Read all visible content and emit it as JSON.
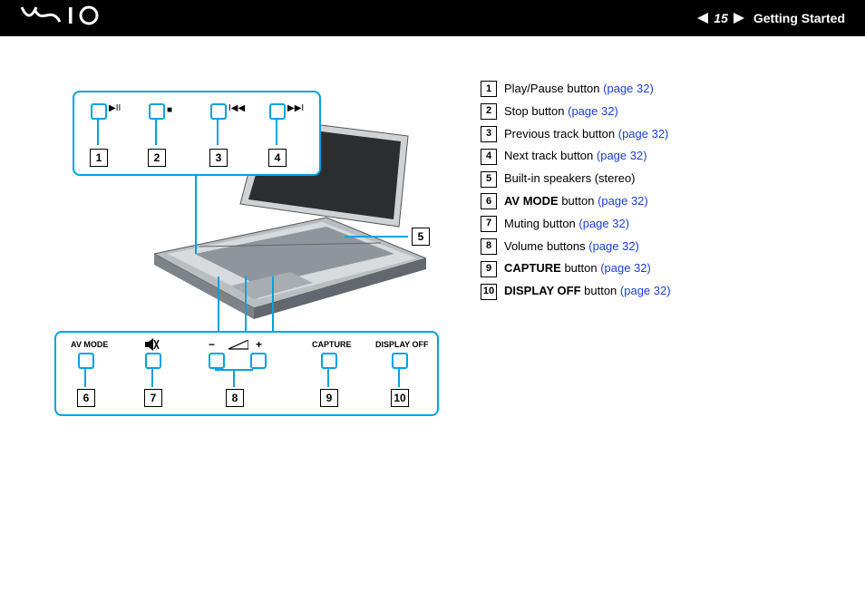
{
  "header": {
    "logo_text": "VAIO",
    "page_number": "15",
    "section": "Getting Started"
  },
  "callouts": {
    "top_numbers": [
      "1",
      "2",
      "3",
      "4"
    ],
    "bottom_numbers": [
      "6",
      "7",
      "8",
      "9",
      "10"
    ],
    "side_number": "5",
    "bottom_labels": {
      "av_mode": "AV MODE",
      "capture": "CAPTURE",
      "display_off": "DISPLAY OFF",
      "minus": "−",
      "plus": "+"
    },
    "media_icons": {
      "play_pause": "▶II",
      "stop": "■",
      "prev": "I◀◀",
      "next": "▶▶I"
    }
  },
  "legend": [
    {
      "n": "1",
      "text": "Play/Pause button ",
      "link": "(page 32)"
    },
    {
      "n": "2",
      "text": "Stop button ",
      "link": "(page 32)"
    },
    {
      "n": "3",
      "text": "Previous track button ",
      "link": "(page 32)"
    },
    {
      "n": "4",
      "text": "Next track button ",
      "link": "(page 32)"
    },
    {
      "n": "5",
      "text": "Built-in speakers (stereo)",
      "link": ""
    },
    {
      "n": "6",
      "bold": "AV MODE",
      "text": " button ",
      "link": "(page 32)"
    },
    {
      "n": "7",
      "text": "Muting button ",
      "link": "(page 32)"
    },
    {
      "n": "8",
      "text": "Volume buttons ",
      "link": "(page 32)"
    },
    {
      "n": "9",
      "bold": "CAPTURE",
      "text": " button ",
      "link": "(page 32)"
    },
    {
      "n": "10",
      "bold": "DISPLAY OFF",
      "text": " button ",
      "link": "(page 32)"
    }
  ]
}
